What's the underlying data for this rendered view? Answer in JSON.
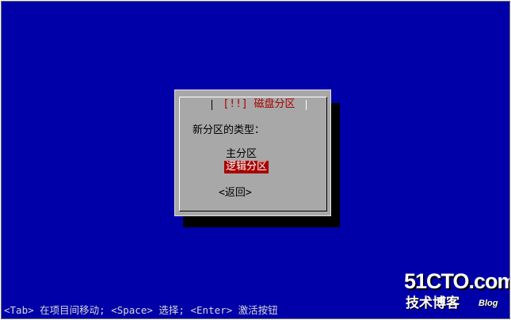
{
  "dialog": {
    "title": "[!!] 磁盘分区",
    "prompt": "新分区的类型：",
    "options": [
      {
        "label": "主分区",
        "selected": false
      },
      {
        "label": "逻辑分区",
        "selected": true
      }
    ],
    "back_label": "<返回>"
  },
  "status_bar": {
    "text": "<Tab> 在项目间移动; <Space> 选择; <Enter> 激活按钮"
  },
  "watermark": {
    "site": "51CTO.com",
    "subtitle": "技术博客",
    "blog": "Blog"
  },
  "colors": {
    "screen_background": "#0000a8",
    "dialog_background": "#a8a8a8",
    "title_text": "#a80000",
    "selection_background": "#a80000",
    "selection_text": "#ffffff"
  }
}
